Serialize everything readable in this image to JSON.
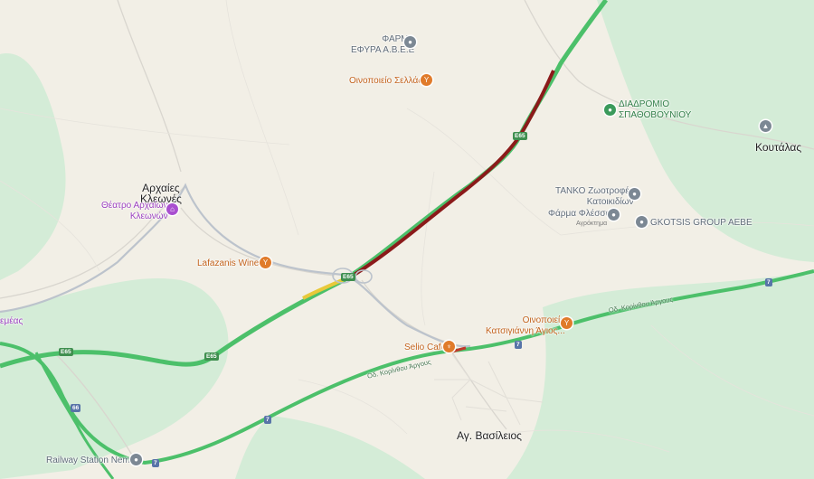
{
  "places": {
    "archaies_kleones": "Αρχαίες\nΚλεωνές",
    "koutalas": "Κουτάλας",
    "ag_vasileios": "Αγ. Βασίλειος",
    "nemea_edge": "εμέας"
  },
  "pois": {
    "farma_efyra": "ΦΑΡΜΑ\nΕΦΥΡΑ Α.Β.Ε.Ε",
    "oinopoieio_sellas": "Οινοποιείο Σελλάς",
    "diadromio": "ΔΙΑΔΡΟΜΙΟ\nΣΠΑΘΟΒΟΥΝΙΟΥ",
    "theatro": "Θέατρο Αρχαίων\nΚλεωνών",
    "tanko": "ΤΑΝΚΟ Ζωοτροφές\nΚατοικιδίων",
    "farma_flessas": "Φάρμα Φλέσσας",
    "farma_flessas_sub": "Αγρόκτημα",
    "gkotsis": "GKOTSIS GROUP AEBE",
    "lafazanis": "Lafazanis Winery",
    "katsigianni": "Οινοποιείο\nΚατσιγιάννη Άγιος...",
    "selio": "Selio Cafe",
    "railway": "Railway Station Nemea"
  },
  "roads": {
    "odos_korinthou_east": "Οδ. Κορίνθου Άργους",
    "odos_korinthou_town": "Οδ. Κορίνθου Άργους"
  },
  "shields": {
    "e65_a": "E65",
    "e65_b": "E65",
    "e65_c": "E65",
    "e65_d": "E65",
    "r7_a": "7",
    "r7_b": "7",
    "r7_c": "7",
    "r7_d": "7",
    "r66": "66"
  },
  "icons": {
    "winery": "wine-glass-icon",
    "generic": "pin-icon",
    "park": "park-icon",
    "theater": "landmark-icon",
    "cafe": "restaurant-icon",
    "station": "train-station-icon"
  },
  "colors": {
    "land": "#f2efe6",
    "green_area": "#d4ecd7",
    "highway": "#4cc06a",
    "traffic_heavy": "#8b1a1a",
    "traffic_slow": "#e8c93a"
  }
}
